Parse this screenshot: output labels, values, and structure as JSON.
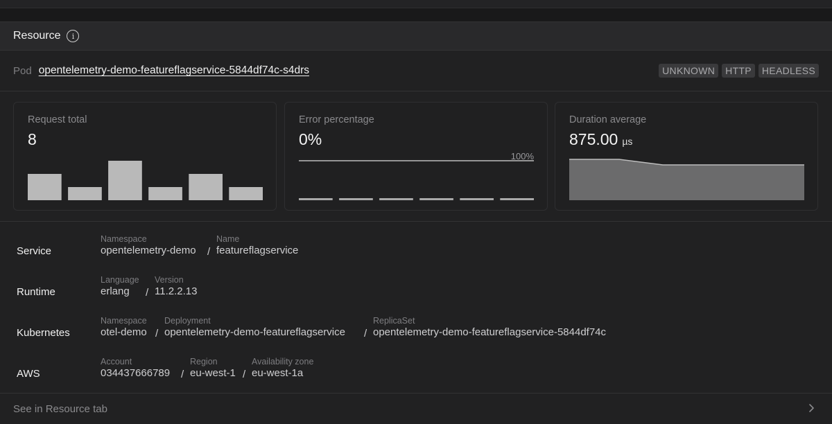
{
  "panel": {
    "title": "Resource"
  },
  "pod": {
    "label": "Pod",
    "name": "opentelemetry-demo-featureflagservice-5844df74c-s4drs",
    "badges": [
      "UNKNOWN",
      "HTTP",
      "HEADLESS"
    ]
  },
  "cards": {
    "requests": {
      "label": "Request total",
      "value": "8"
    },
    "errors": {
      "label": "Error percentage",
      "value": "0%",
      "max_label": "100%"
    },
    "duration": {
      "label": "Duration average",
      "value": "875.00",
      "unit": "µs"
    }
  },
  "chart_data": [
    {
      "type": "bar",
      "title": "Request total",
      "values": [
        2,
        1,
        3,
        1,
        2,
        1
      ]
    },
    {
      "type": "bar",
      "title": "Error percentage",
      "values": [
        0,
        0,
        0,
        0,
        0,
        0
      ],
      "ylim": [
        0,
        100
      ]
    },
    {
      "type": "area",
      "title": "Duration average",
      "shape": "slight decline then flat"
    }
  ],
  "sections": {
    "service": {
      "label": "Service",
      "ns_label": "Namespace",
      "ns": "opentelemetry-demo",
      "name_label": "Name",
      "name": "featureflagservice"
    },
    "runtime": {
      "label": "Runtime",
      "lang_label": "Language",
      "lang": "erlang",
      "ver_label": "Version",
      "ver": "11.2.2.13"
    },
    "kubernetes": {
      "label": "Kubernetes",
      "ns_label": "Namespace",
      "ns": "otel-demo",
      "dep_label": "Deployment",
      "dep": "opentelemetry-demo-featureflagservice",
      "rs_label": "ReplicaSet",
      "rs": "opentelemetry-demo-featureflagservice-5844df74c"
    },
    "aws": {
      "label": "AWS",
      "acct_label": "Account",
      "acct": "034437666789",
      "region_label": "Region",
      "region": "eu-west-1",
      "az_label": "Availability zone",
      "az": "eu-west-1a"
    }
  },
  "separator": "/",
  "footer": {
    "link": "See in Resource tab"
  },
  "icons": {
    "info": "info-icon",
    "chevron": "chevron-right-icon"
  }
}
